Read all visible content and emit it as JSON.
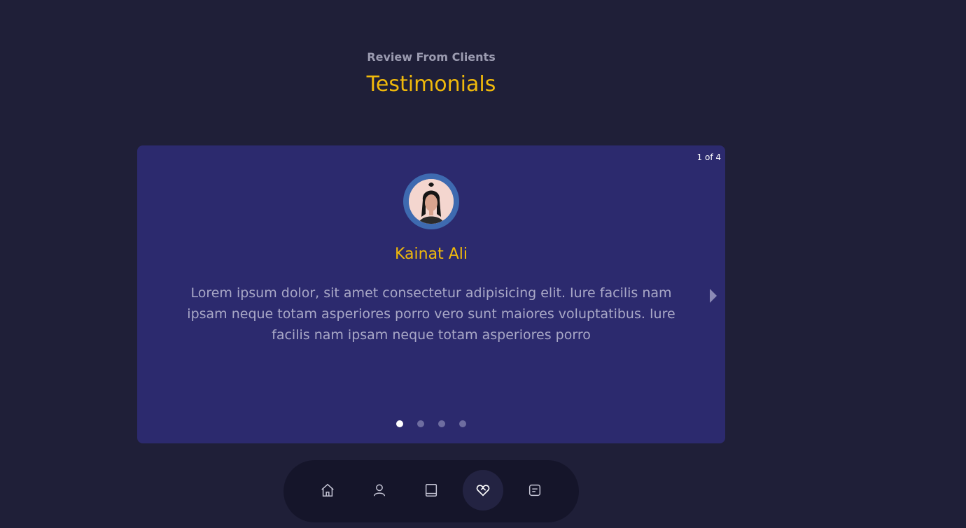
{
  "header": {
    "subtitle": "Review From Clients",
    "title": "Testimonials"
  },
  "testimonial": {
    "counter": "1 of 4",
    "name": "Kainat Ali",
    "quote": "Lorem ipsum dolor, sit amet consectetur adipisicing elit. Iure facilis nam ipsam neque totam asperiores porro vero sunt maiores voluptatibus. Iure facilis nam ipsam neque totam asperiores porro",
    "current_index": 1,
    "total": 4
  },
  "nav": {
    "items": [
      {
        "icon": "home-icon",
        "active": false
      },
      {
        "icon": "user-icon",
        "active": false
      },
      {
        "icon": "book-icon",
        "active": false
      },
      {
        "icon": "heart-handshake-icon",
        "active": true
      },
      {
        "icon": "message-icon",
        "active": false
      }
    ]
  },
  "colors": {
    "background": "#1f1f38",
    "card": "#2c2a6e",
    "accent": "#f0b90b",
    "avatar_ring": "#3e6ab0",
    "navbar": "#15152a"
  }
}
